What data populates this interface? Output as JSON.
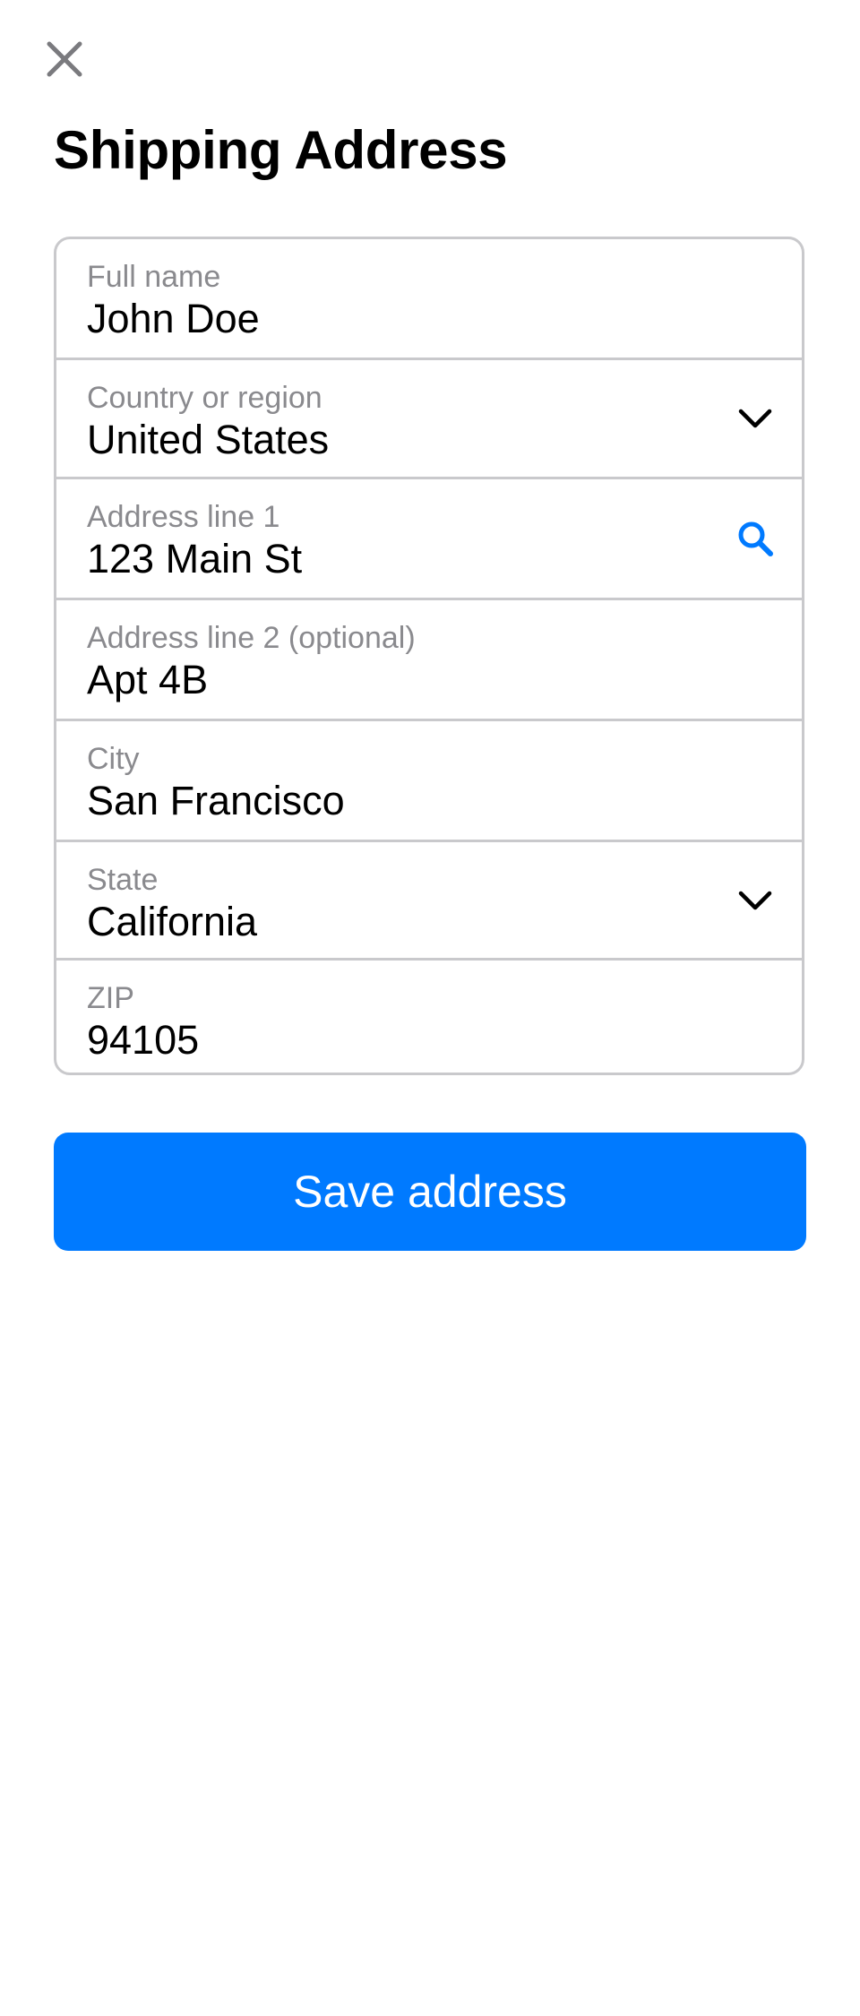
{
  "header": {
    "close_icon": "close-icon",
    "title": "Shipping Address"
  },
  "form": {
    "fields": [
      {
        "label": "Full name",
        "value": "John Doe",
        "icon": null
      },
      {
        "label": "Country or region",
        "value": "United States",
        "icon": "chevron-down-icon"
      },
      {
        "label": "Address line 1",
        "value": "123 Main St",
        "icon": "search-icon"
      },
      {
        "label": "Address line 2 (optional)",
        "value": "Apt 4B",
        "icon": null
      },
      {
        "label": "City",
        "value": "San Francisco",
        "icon": null
      },
      {
        "label": "State",
        "value": "California",
        "icon": "chevron-down-icon"
      },
      {
        "label": "ZIP",
        "value": "94105",
        "icon": null
      }
    ]
  },
  "actions": {
    "save_label": "Save address"
  },
  "colors": {
    "accent": "#007aff",
    "label_gray": "#8a8a8e",
    "border": "#c9c9cc",
    "close_icon": "#7a7a7e"
  }
}
